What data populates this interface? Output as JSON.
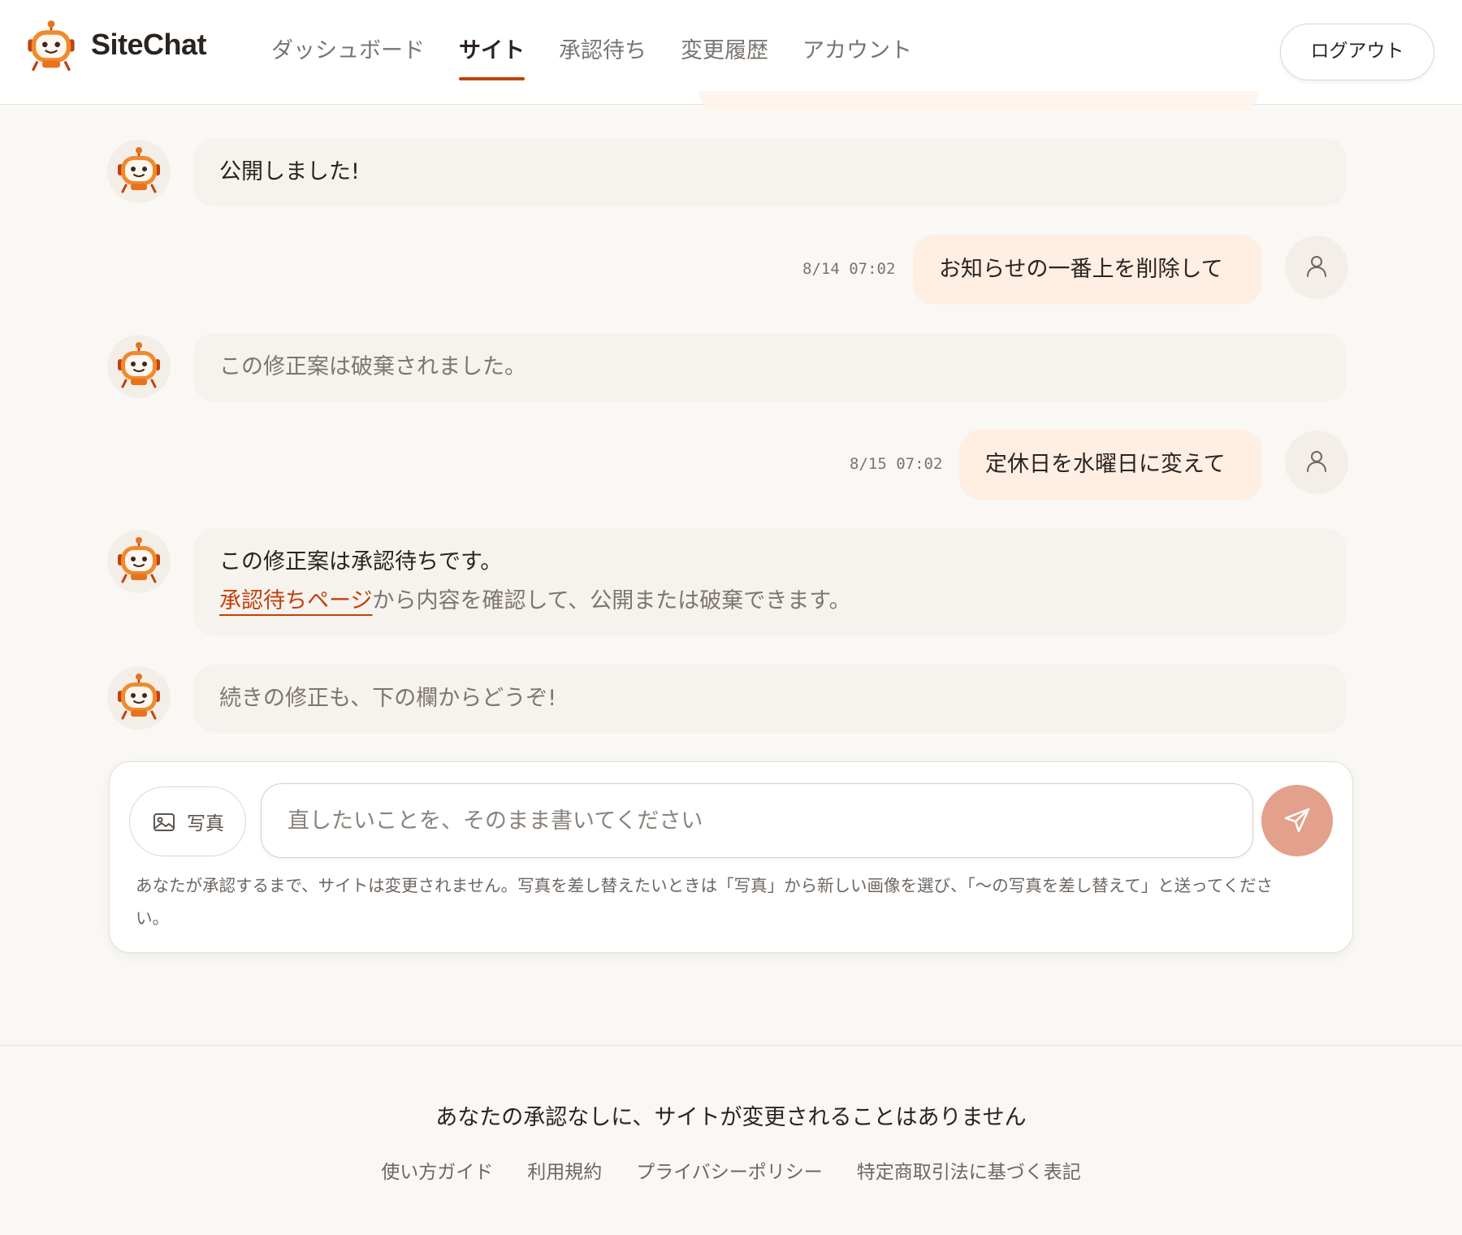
{
  "app": {
    "brand": "SiteChat",
    "logo_icon": "robot-mascot-icon",
    "accent_color": "#c2410c"
  },
  "nav": {
    "items": [
      {
        "label": "ダッシュボード",
        "active": false
      },
      {
        "label": "サイト",
        "active": true
      },
      {
        "label": "承認待ち",
        "active": false
      },
      {
        "label": "変更履歴",
        "active": false
      },
      {
        "label": "アカウント",
        "active": false
      }
    ],
    "logout_label": "ログアウト"
  },
  "messages": [
    {
      "role": "bot",
      "text": "公開しました!"
    },
    {
      "role": "user",
      "time": "8/14 07:02",
      "text": "お知らせの一番上を削除して"
    },
    {
      "role": "bot",
      "text": "この修正案は破棄されました。"
    },
    {
      "role": "user",
      "time": "8/15 07:02",
      "text": "定休日を水曜日に変えて"
    },
    {
      "role": "bot",
      "line1": "この修正案は承認待ちです。",
      "link_text": "承認待ちページ",
      "line2_rest": "から内容を確認して、公開または破棄できます。"
    },
    {
      "role": "bot",
      "text": "続きの修正も、下の欄からどうぞ!"
    }
  ],
  "composer": {
    "photo_label": "写真",
    "placeholder": "直したいことを、そのまま書いてください",
    "value": "",
    "send_icon": "send-icon",
    "send_color": "#e3a08a",
    "note": "あなたが承認するまで、サイトは変更されません。写真を差し替えたいときは「写真」から新しい画像を選び、「〜の写真を差し替えて」と送ってください。"
  },
  "footer": {
    "tagline": "あなたの承認なしに、サイトが変更されることはありません",
    "links": [
      "使い方ガイド",
      "利用規約",
      "プライバシーポリシー",
      "特定商取引法に基づく表記"
    ]
  }
}
